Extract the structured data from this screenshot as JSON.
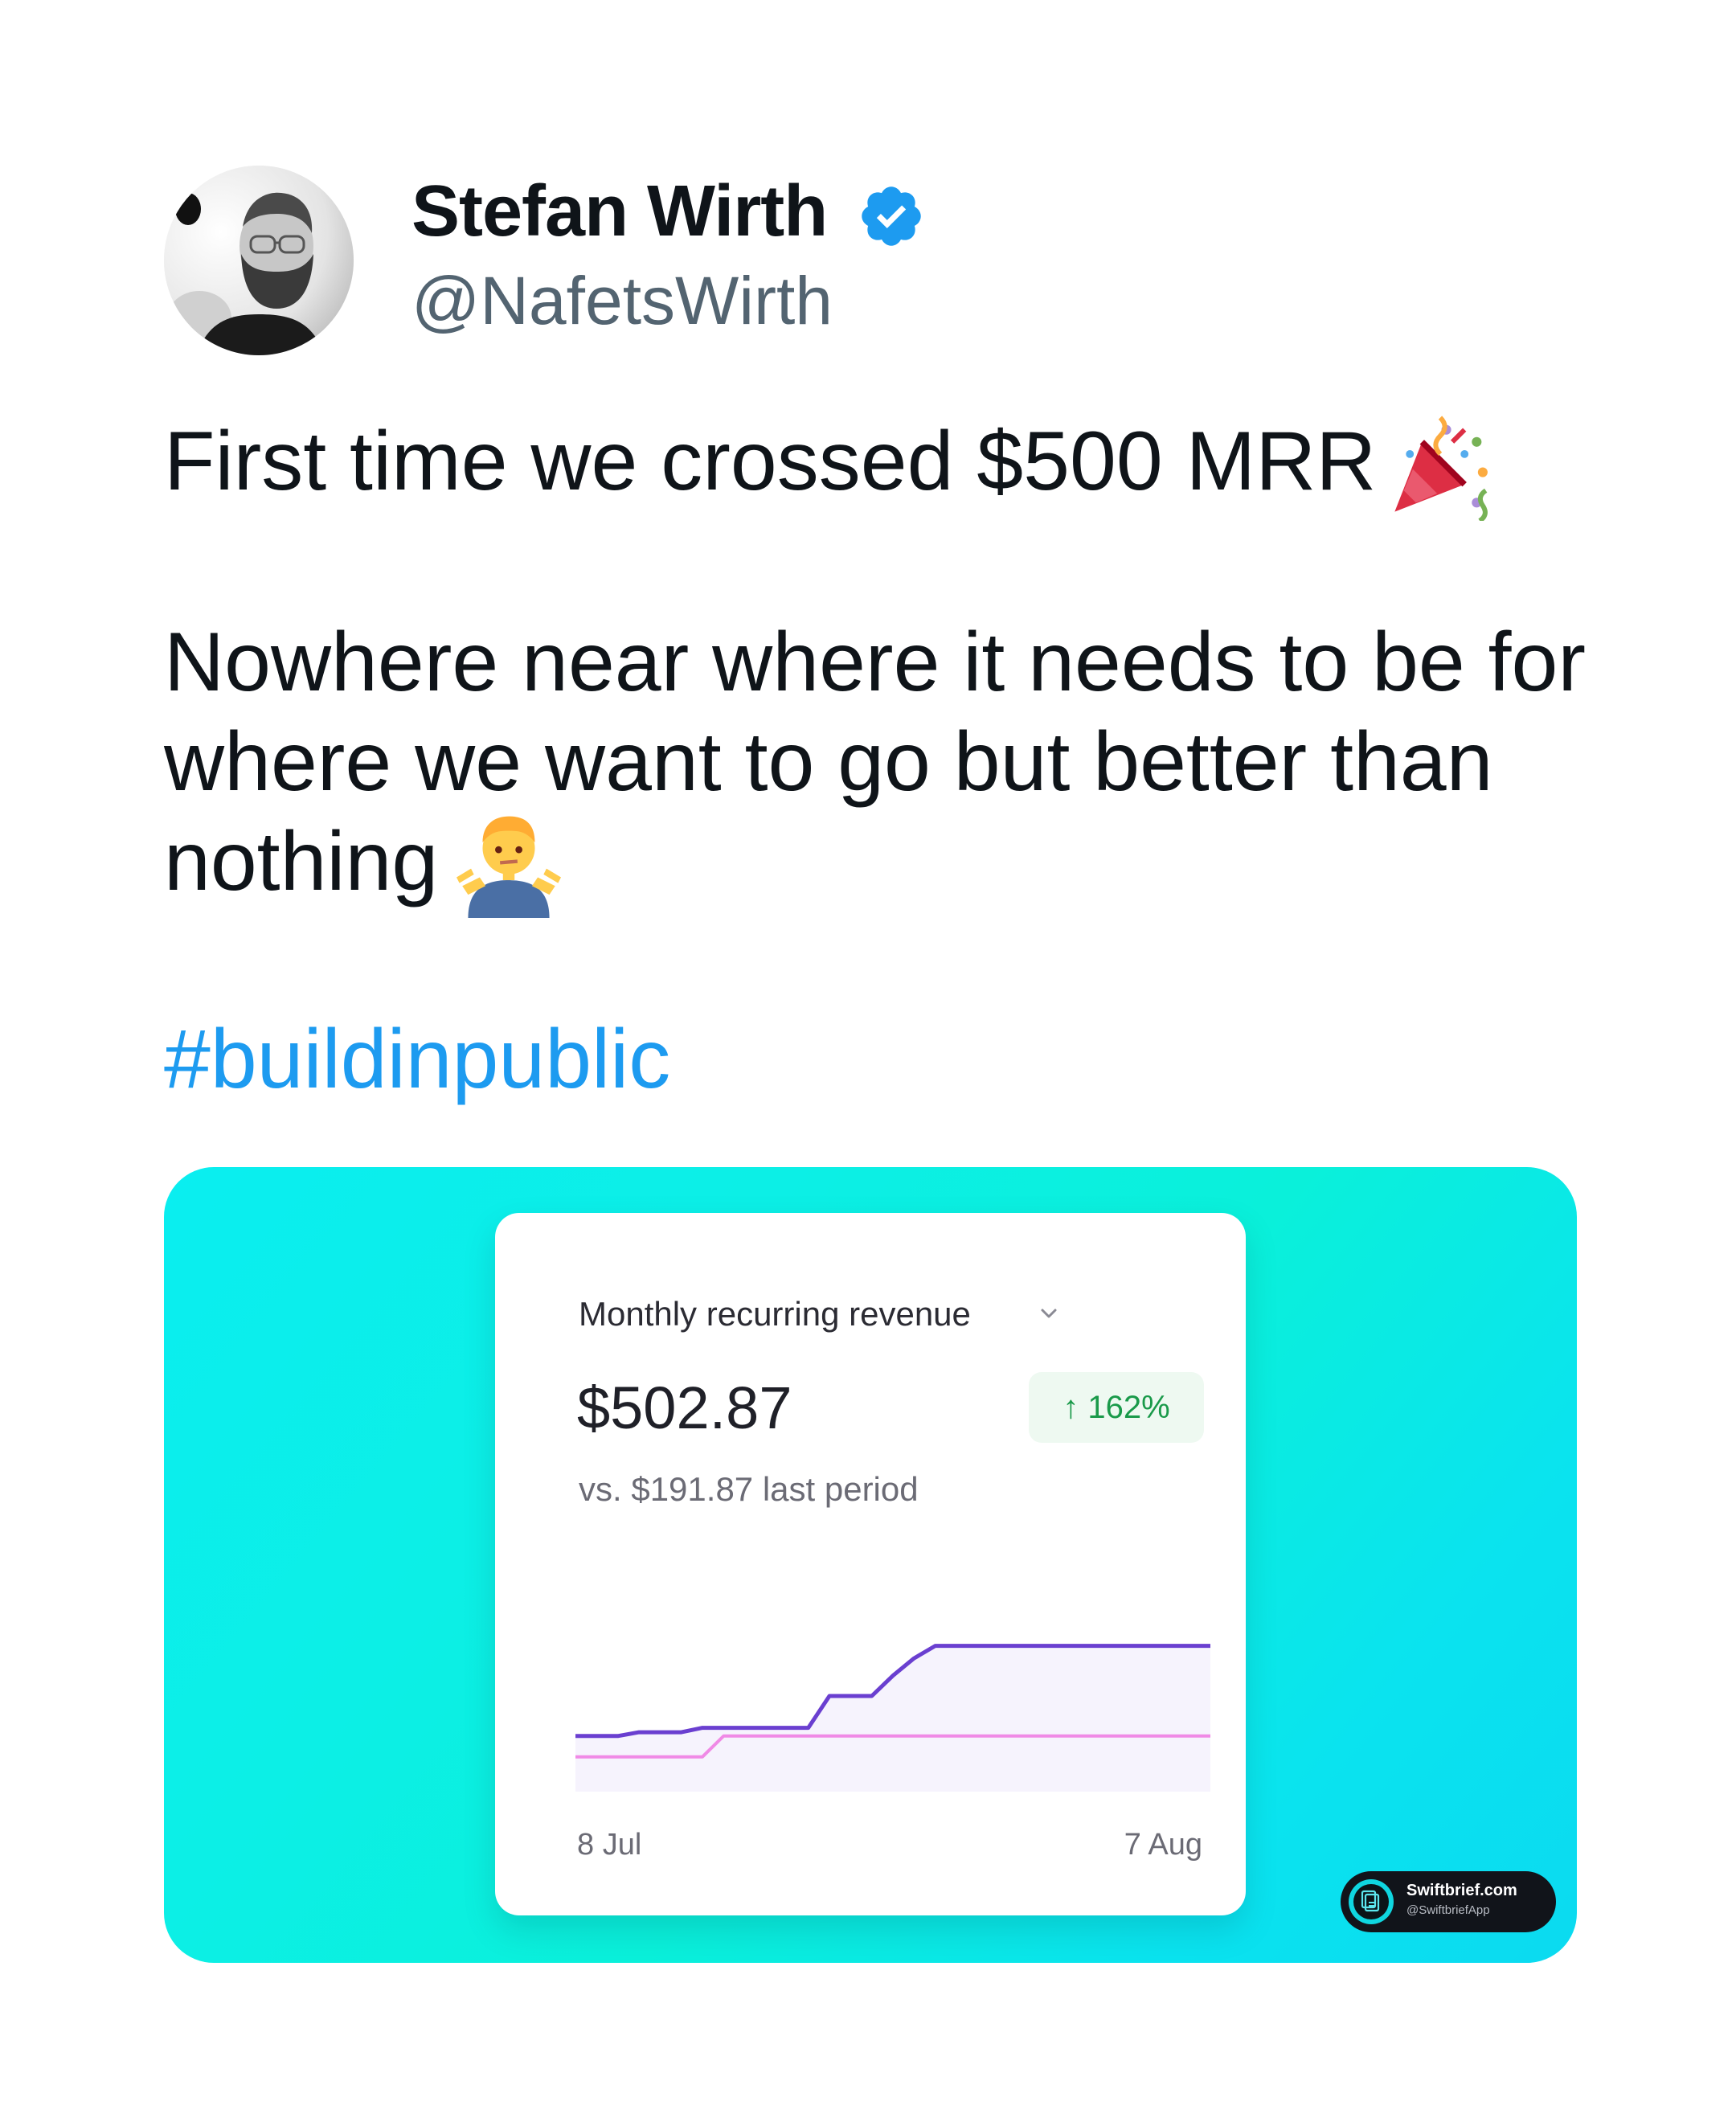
{
  "author": {
    "name": "Stefan Wirth",
    "handle": "@NafetsWirth",
    "verified_icon": "verified-badge-icon"
  },
  "tweet": {
    "line1": "First time we crossed $500 MRR",
    "line1_emoji": "party-popper-icon",
    "line2": "Nowhere near where it needs to be for",
    "line3": "where we want to go but better than",
    "line4": "nothing",
    "line4_emoji": "person-shrugging-icon",
    "hashtag": "#buildinpublic"
  },
  "colors": {
    "hashtag": "#1d9bf0",
    "verified": "#1d9bf0",
    "media_gradient_start": "#0aeef0",
    "media_gradient_end": "#0bdaf0",
    "current_line": "#6a3fd0",
    "previous_line": "#f08ae6",
    "badge_text": "#1a9a4a"
  },
  "revenue_card": {
    "title": "Monthly recurring revenue",
    "amount": "$502.87",
    "change_badge": "↑ 162%",
    "comparison": "vs. $191.87 last period",
    "chart_data": {
      "type": "line",
      "x_start_label": "8 Jul",
      "x_end_label": "7 Aug",
      "grid": false,
      "series": [
        {
          "color": "#6a3fd0",
          "values": [
            191.87,
            191.87,
            191.87,
            205,
            205,
            205,
            220,
            220,
            220,
            220,
            220,
            220,
            330,
            330,
            330,
            400,
            460,
            502.87,
            502.87,
            502.87,
            502.87,
            502.87,
            502.87,
            502.87,
            502.87,
            502.87,
            502.87,
            502.87,
            502.87,
            502.87,
            502.87
          ]
        },
        {
          "color": "#f08ae6",
          "values": [
            120,
            120,
            120,
            120,
            120,
            120,
            120,
            191.87,
            191.87,
            191.87,
            191.87,
            191.87,
            191.87,
            191.87,
            191.87,
            191.87,
            191.87,
            191.87,
            191.87,
            191.87,
            191.87,
            191.87,
            191.87,
            191.87,
            191.87,
            191.87,
            191.87,
            191.87,
            191.87,
            191.87,
            191.87
          ]
        }
      ],
      "y_range": [
        0,
        560
      ]
    }
  },
  "watermark": {
    "name": "Swiftbrief.com",
    "handle": "@SwiftbriefApp"
  }
}
